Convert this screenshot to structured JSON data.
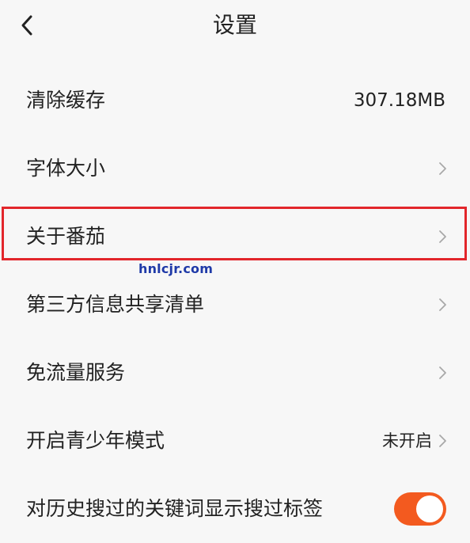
{
  "header": {
    "title": "设置"
  },
  "rows": [
    {
      "label": "清除缓存",
      "value": "307.18MB"
    },
    {
      "label": "字体大小"
    },
    {
      "label": "关于番茄"
    },
    {
      "label": "第三方信息共享清单"
    },
    {
      "label": "免流量服务"
    },
    {
      "label": "开启青少年模式",
      "value": "未开启"
    },
    {
      "label": "对历史搜过的关键词显示搜过标签",
      "toggle_on": true
    }
  ],
  "watermark": "hnlcjr.com",
  "colors": {
    "accent": "#f35a1f",
    "highlight": "#e2262b",
    "background": "#f7f7f7"
  },
  "icons": {
    "back": "chevron-left-icon",
    "row_arrow": "chevron-right-icon"
  }
}
